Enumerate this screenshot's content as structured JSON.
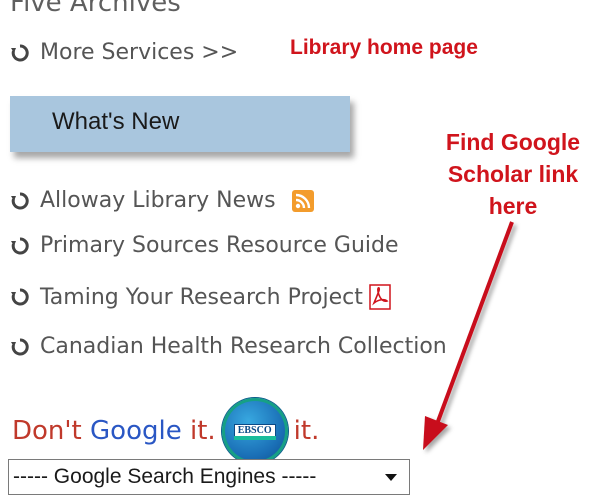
{
  "sidebar": {
    "truncated_item": "Five Archives",
    "more_services": "More Services >>",
    "whats_new": "What's New",
    "links": [
      {
        "label": "Alloway Library News",
        "icon": "rss-icon"
      },
      {
        "label": "Primary Sources Resource Guide",
        "icon": null
      },
      {
        "label": "Taming Your Research Project",
        "icon": "pdf-icon"
      },
      {
        "label": "Canadian Health Research Collection",
        "icon": null
      }
    ],
    "promo": {
      "dont": "Don't",
      "google": "Google",
      "it1": "it.",
      "it2": "it.",
      "logo_text": "EBSCO"
    },
    "select": {
      "value": "----- Google Search Engines -----"
    }
  },
  "annotations": {
    "library_home": "Library home page",
    "find_google": "Find Google",
    "scholar_link": "Scholar link",
    "here": "here"
  },
  "colors": {
    "annotation_red": "#d0141c",
    "whats_new_bg": "#a9c6de",
    "google_blue": "#2a57c4"
  }
}
